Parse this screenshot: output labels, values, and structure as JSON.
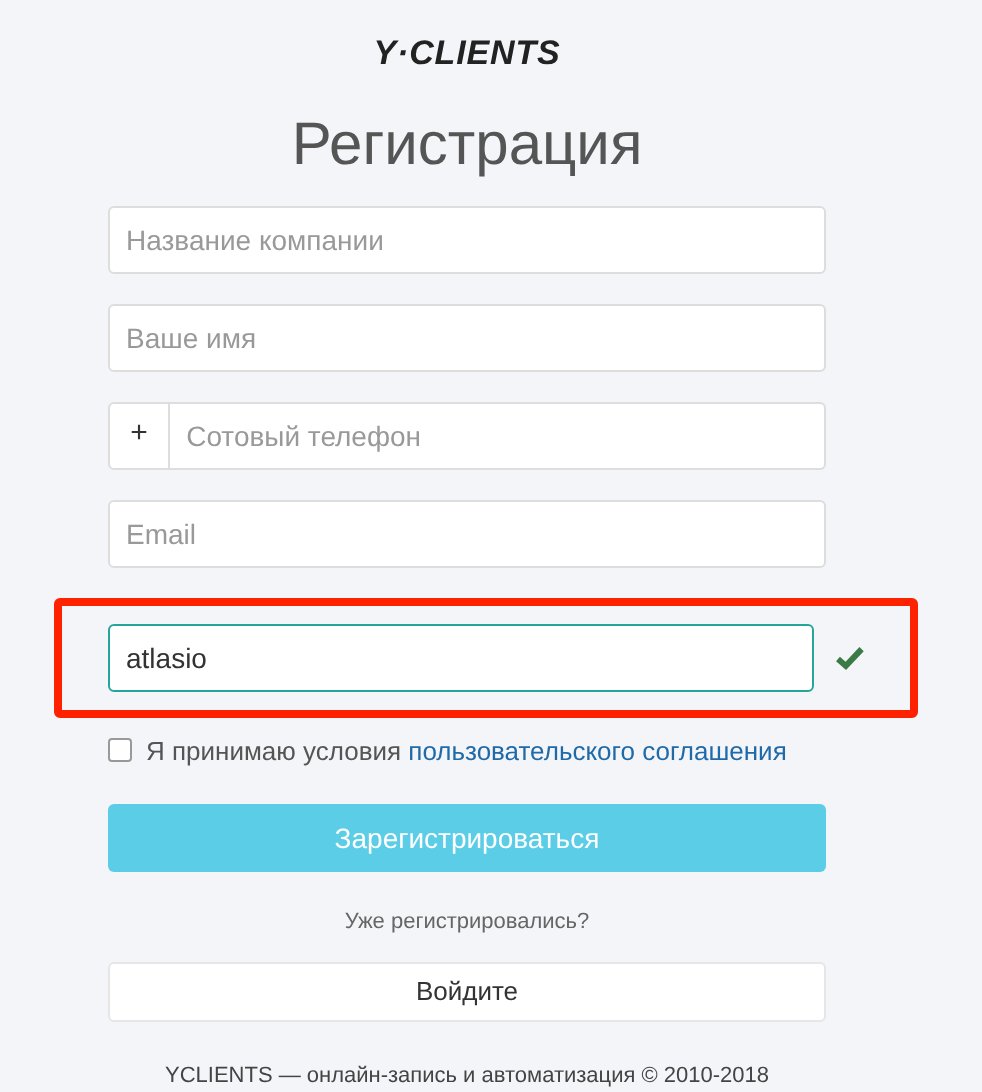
{
  "logo": "Y·CLIENTS",
  "title": "Регистрация",
  "fields": [
    {
      "kind": "text",
      "placeholder": "Название компании"
    },
    {
      "kind": "text",
      "placeholder": "Ваше имя"
    },
    {
      "kind": "phone",
      "prefix": "+",
      "placeholder": "Сотовый телефон"
    },
    {
      "kind": "text",
      "placeholder": "Email"
    },
    {
      "kind": "text",
      "value": "atlasio",
      "valid": true,
      "highlighted": true
    }
  ],
  "agreement": {
    "checked": false,
    "text": "Я принимаю условия",
    "link": "пользовательского соглашения"
  },
  "register_button": "Зарегистрироваться",
  "already_text": "Уже регистрировались?",
  "login_button": "Войдите",
  "footer": "YCLIENTS — онлайн-запись и автоматизация © 2010-2018"
}
